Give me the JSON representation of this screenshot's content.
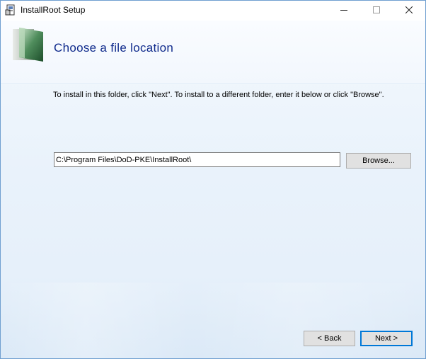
{
  "window": {
    "title": "InstallRoot Setup",
    "icon": "installer-icon",
    "controls": [
      "minimize-icon",
      "maximize-icon",
      "close-icon"
    ]
  },
  "header": {
    "title": "Choose a file location",
    "icon": "folder-graphic-icon"
  },
  "body": {
    "instruction": "To install in this folder, click \"Next\". To install to a different folder, enter it below or click \"Browse\".",
    "install_path": "C:\\Program Files\\DoD-PKE\\InstallRoot\\",
    "browse_label": "Browse..."
  },
  "footer": {
    "back_label": "< Back",
    "next_label": "Next >"
  },
  "colors": {
    "header_title": "#0f2a8c",
    "focus_border": "#0078d7",
    "background": "#e9f2fb"
  }
}
